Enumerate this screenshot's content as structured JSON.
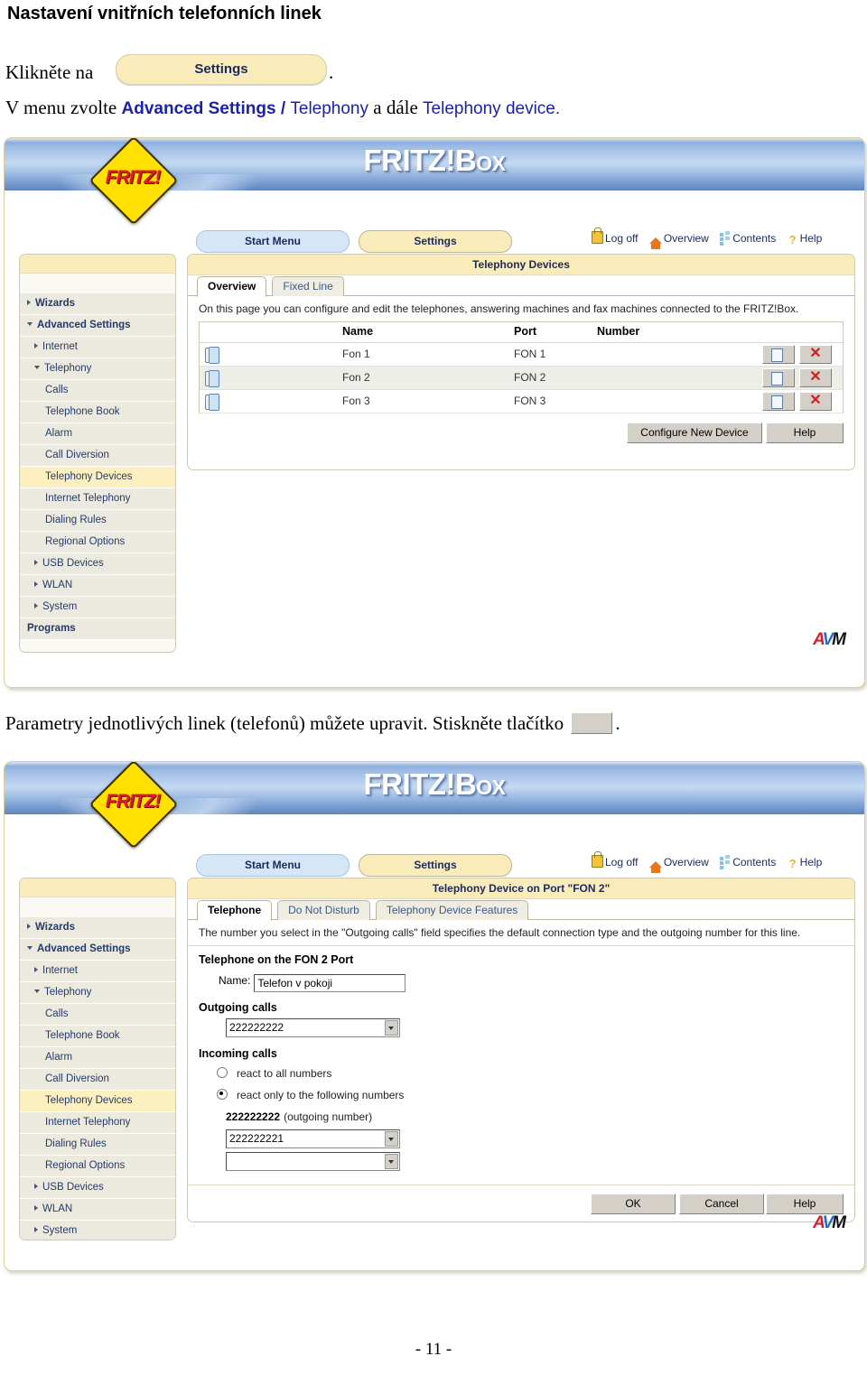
{
  "document": {
    "title": "Nastavení vnitřních telefonních linek",
    "line1_prefix": "Klikněte na",
    "settings_button_label": "Settings",
    "line1_suffix": ".",
    "line2_prefix": "V menu zvolte",
    "line2_bold": "Advanced Settings /",
    "line2_mid": "Telephony",
    "line2_plain": "a dále",
    "line2_end": "Telephony device.",
    "line3": "Parametry jednotlivých linek (telefonů) můžete upravit. Stiskněte tlačítko",
    "line3_end": ".",
    "page_number": "- 11 -",
    "accent_blue": "#1b22a8"
  },
  "fritzbox": {
    "banner_title": "FRITZ!Box",
    "logo_text": "FRITZ!",
    "nav": {
      "start_menu": "Start Menu",
      "settings": "Settings",
      "links": [
        {
          "label": "Log off",
          "icon": "lock-icon"
        },
        {
          "label": "Overview",
          "icon": "home-icon"
        },
        {
          "label": "Contents",
          "icon": "contents-icon"
        },
        {
          "label": "Help",
          "icon": "question-icon"
        }
      ]
    },
    "sidebar": [
      {
        "label": "Wizards",
        "level": 1,
        "arrow": "right",
        "selected": false
      },
      {
        "label": "Advanced Settings",
        "level": 1,
        "arrow": "down",
        "selected": false
      },
      {
        "label": "Internet",
        "level": 2,
        "arrow": "right",
        "selected": false
      },
      {
        "label": "Telephony",
        "level": 2,
        "arrow": "down",
        "selected": false
      },
      {
        "label": "Calls",
        "level": 3,
        "arrow": "none",
        "selected": false
      },
      {
        "label": "Telephone Book",
        "level": 3,
        "arrow": "none",
        "selected": false
      },
      {
        "label": "Alarm",
        "level": 3,
        "arrow": "none",
        "selected": false
      },
      {
        "label": "Call Diversion",
        "level": 3,
        "arrow": "none",
        "selected": false
      },
      {
        "label": "Telephony Devices",
        "level": 3,
        "arrow": "none",
        "selected": true
      },
      {
        "label": "Internet Telephony",
        "level": 3,
        "arrow": "none",
        "selected": false
      },
      {
        "label": "Dialing Rules",
        "level": 3,
        "arrow": "none",
        "selected": false
      },
      {
        "label": "Regional Options",
        "level": 3,
        "arrow": "none",
        "selected": false
      },
      {
        "label": "USB Devices",
        "level": 2,
        "arrow": "right",
        "selected": false
      },
      {
        "label": "WLAN",
        "level": 2,
        "arrow": "right",
        "selected": false
      },
      {
        "label": "System",
        "level": 2,
        "arrow": "right",
        "selected": false
      },
      {
        "label": "Programs",
        "level": 1,
        "arrow": "none",
        "selected": false
      }
    ],
    "brand_logo": "AVM"
  },
  "screen1": {
    "panel_title": "Telephony Devices",
    "tabs": [
      {
        "label": "Overview",
        "active": true
      },
      {
        "label": "Fixed Line",
        "active": false
      }
    ],
    "intro": "On this page you can configure and edit the telephones, answering machines and fax machines connected to the FRITZ!Box.",
    "table": {
      "headers": [
        "Name",
        "Port",
        "Number"
      ],
      "rows": [
        {
          "icon": "telephone-icon",
          "name": "Fon 1",
          "port": "FON 1",
          "number": ""
        },
        {
          "icon": "telephone-icon",
          "name": "Fon 2",
          "port": "FON 2",
          "number": ""
        },
        {
          "icon": "telephone-icon",
          "name": "Fon 3",
          "port": "FON 3",
          "number": ""
        }
      ],
      "edit_icon": "edit-icon",
      "delete_icon": "delete-x-icon"
    },
    "buttons": {
      "configure_new_device": "Configure New Device",
      "help": "Help"
    }
  },
  "screen2": {
    "panel_title": "Telephony Device on Port \"FON 2\"",
    "tabs": [
      {
        "label": "Telephone",
        "active": true
      },
      {
        "label": "Do Not Disturb",
        "active": false
      },
      {
        "label": "Telephony Device Features",
        "active": false
      }
    ],
    "intro": "The number you select in the \"Outgoing calls\" field specifies the default connection type and the outgoing number for this line.",
    "section_phone": "Telephone on the FON 2 Port",
    "name_label": "Name:",
    "name_value": "Telefon v pokoji",
    "outgoing_calls_label": "Outgoing calls",
    "outgoing_calls_value": "222222222",
    "incoming_calls_label": "Incoming calls",
    "radio_all": "react to all numbers",
    "radio_only": "react only to the following numbers",
    "outgoing_number_bold": "222222222",
    "outgoing_number_note": "(outgoing number)",
    "number_select_1": "222222221",
    "number_select_2": "",
    "buttons": {
      "ok": "OK",
      "cancel": "Cancel",
      "help": "Help"
    }
  }
}
